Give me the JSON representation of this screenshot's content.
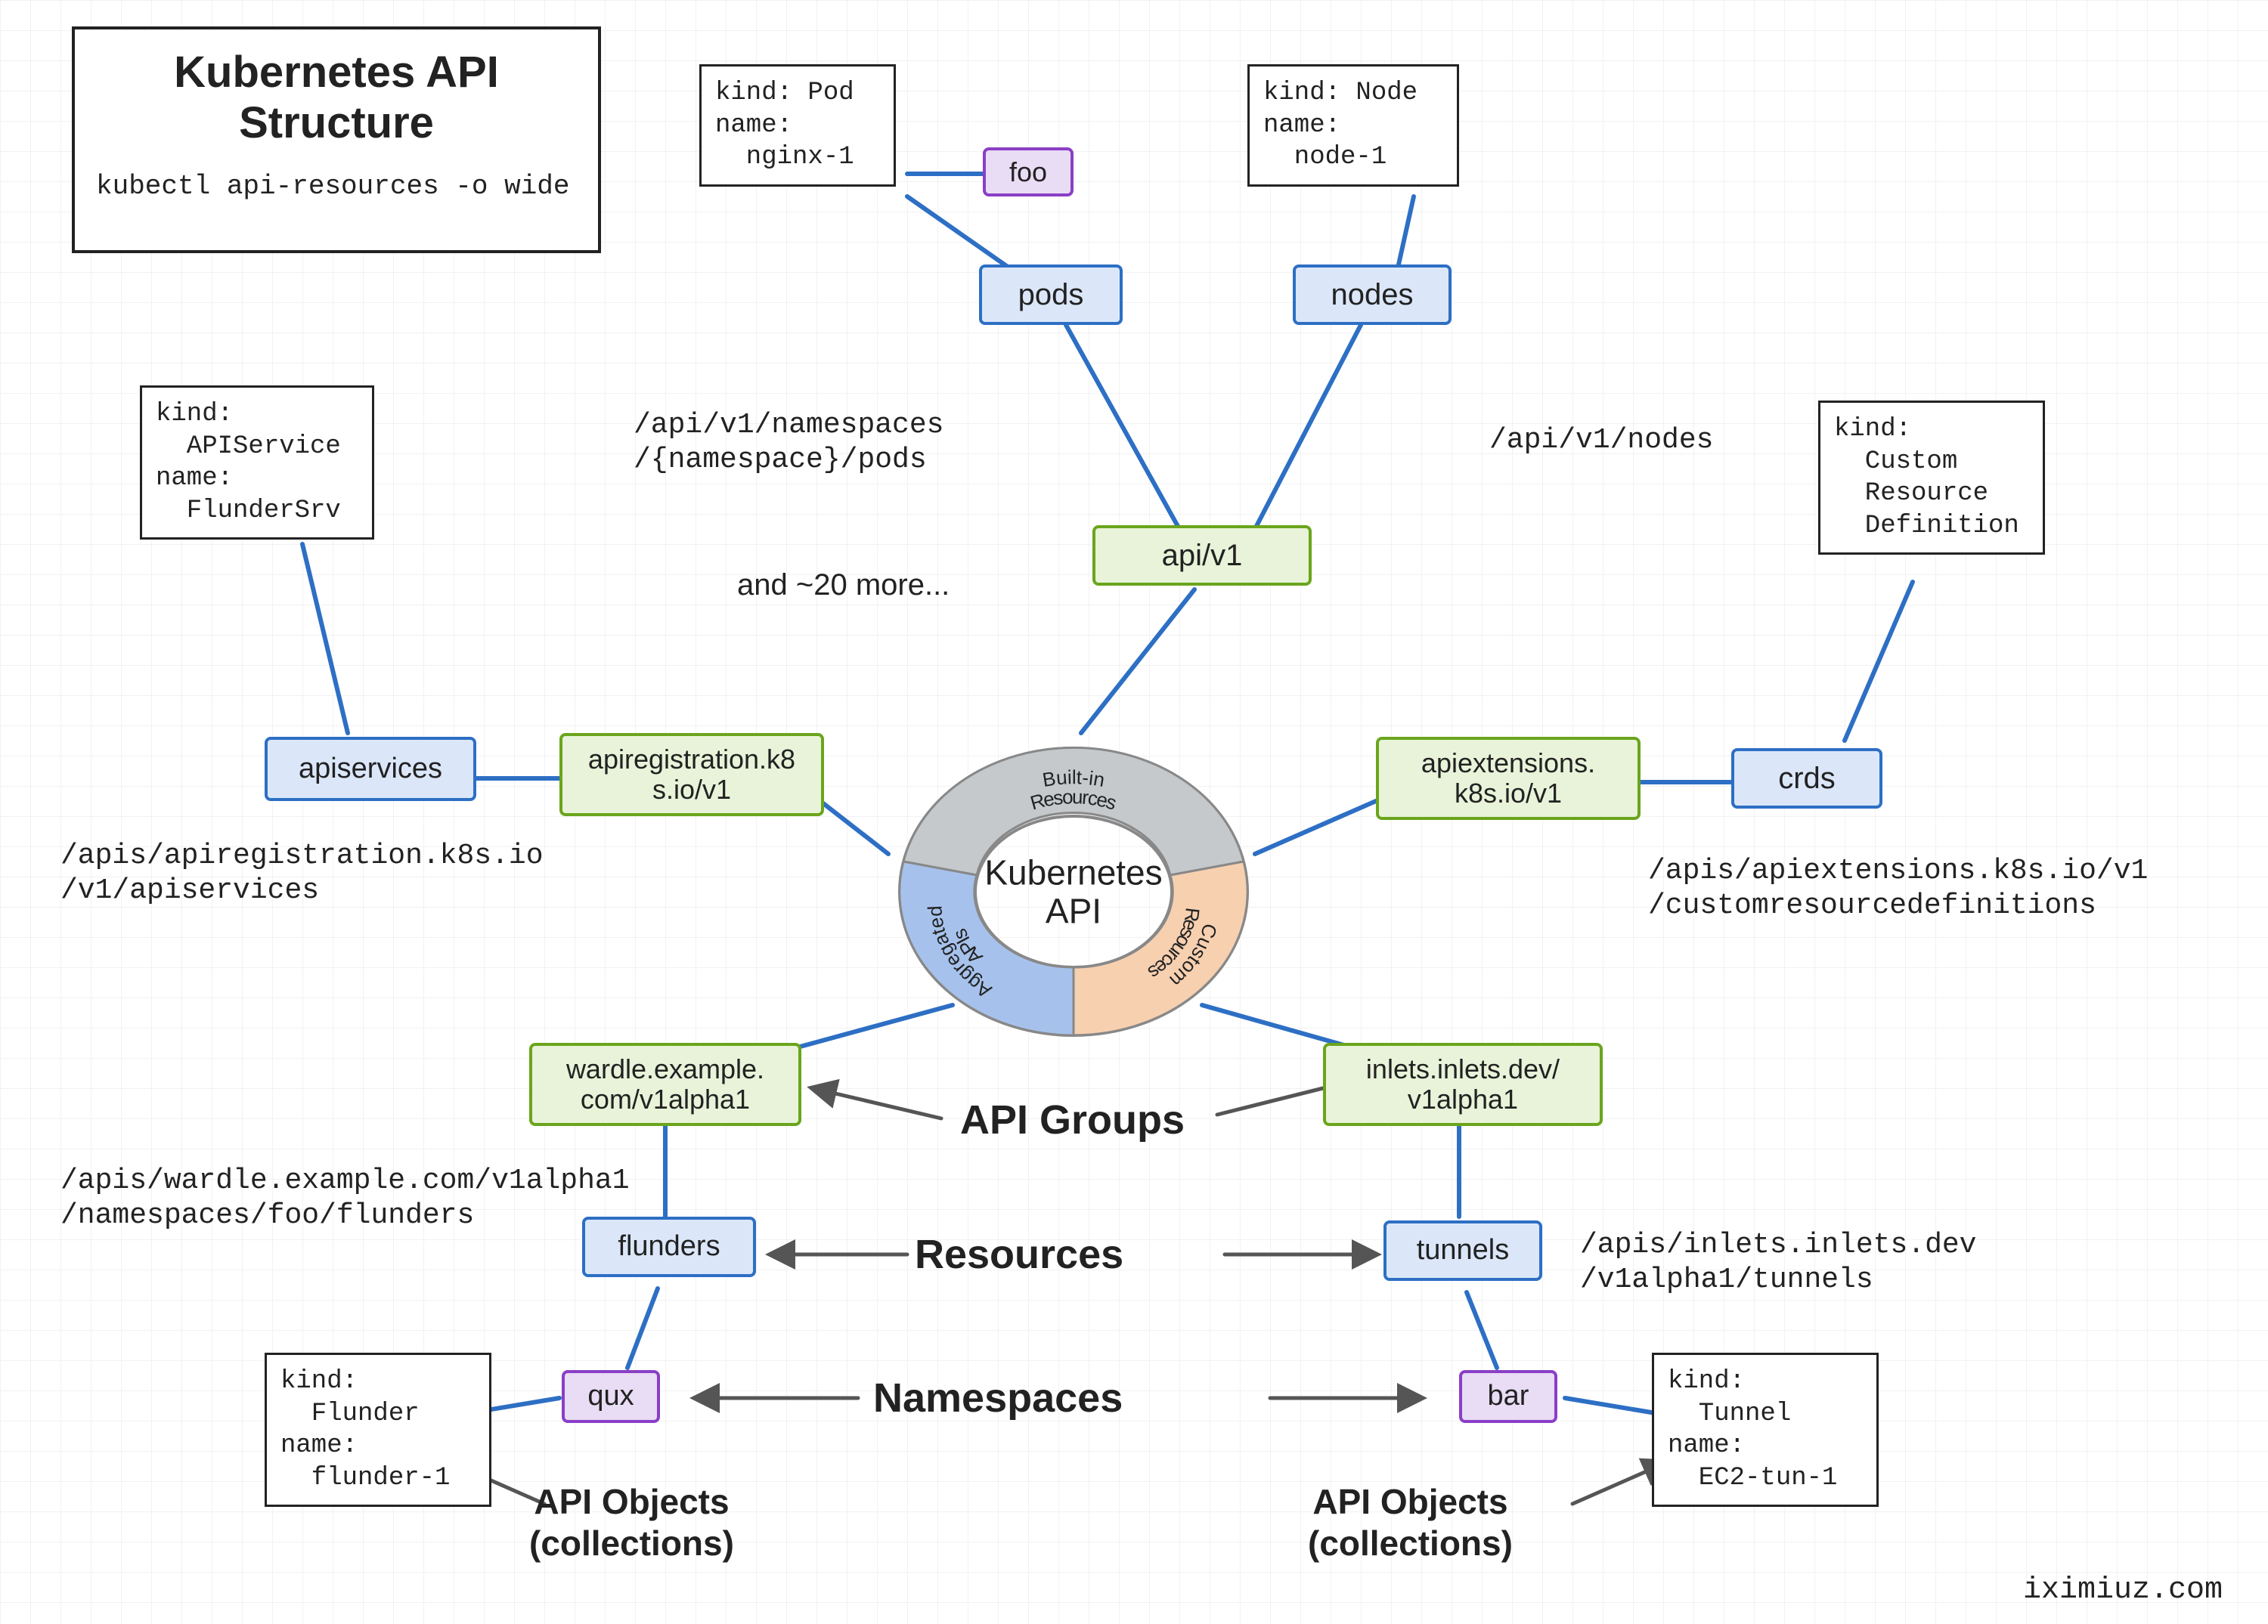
{
  "title": {
    "heading": "Kubernetes API\nStructure",
    "command": "kubectl api-resources -o wide"
  },
  "center": {
    "label": "Kubernetes\nAPI",
    "seg_top": "Built-in\nResources",
    "seg_left": "Aggregated\nAPIs",
    "seg_right": "Custom\nResources"
  },
  "groups": {
    "core": "api/v1",
    "apireg": "apiregistration.k8\ns.io/v1",
    "apiext": "apiextensions.\nk8s.io/v1",
    "wardle": "wardle.example.\ncom/v1alpha1",
    "inlets": "inlets.inlets.dev/\nv1alpha1"
  },
  "resources": {
    "pods": "pods",
    "nodes": "nodes",
    "apiservices": "apiservices",
    "crds": "crds",
    "flunders": "flunders",
    "tunnels": "tunnels"
  },
  "namespaces": {
    "foo": "foo",
    "qux": "qux",
    "bar": "bar"
  },
  "objects": {
    "pod": "kind: Pod\nname:\n  nginx-1",
    "node": "kind: Node\nname:\n  node-1",
    "apiservice": "kind:\n  APIService\nname:\n  FlunderSrv",
    "crd": "kind:\n  Custom\n  Resource\n  Definition",
    "flunder": "kind:\n  Flunder\nname:\n  flunder-1",
    "tunnel": "kind:\n  Tunnel\nname:\n  EC2-tun-1"
  },
  "paths": {
    "pods": "/api/v1/namespaces\n/{namespace}/pods",
    "nodes": "/api/v1/nodes",
    "apiservices": "/apis/apiregistration.k8s.io\n/v1/apiservices",
    "crds": "/apis/apiextensions.k8s.io/v1\n/customresourcedefinitions",
    "flunders": "/apis/wardle.example.com/v1alpha1\n/namespaces/foo/flunders",
    "tunnels": "/apis/inlets.inlets.dev\n/v1alpha1/tunnels"
  },
  "asides": {
    "and_more": "and ~20 more...",
    "api_groups": "API Groups",
    "resources": "Resources",
    "namespaces": "Namespaces",
    "api_objects_left": "API Objects\n(collections)",
    "api_objects_right": "API Objects\n(collections)"
  },
  "credit": "iximiuz.com"
}
